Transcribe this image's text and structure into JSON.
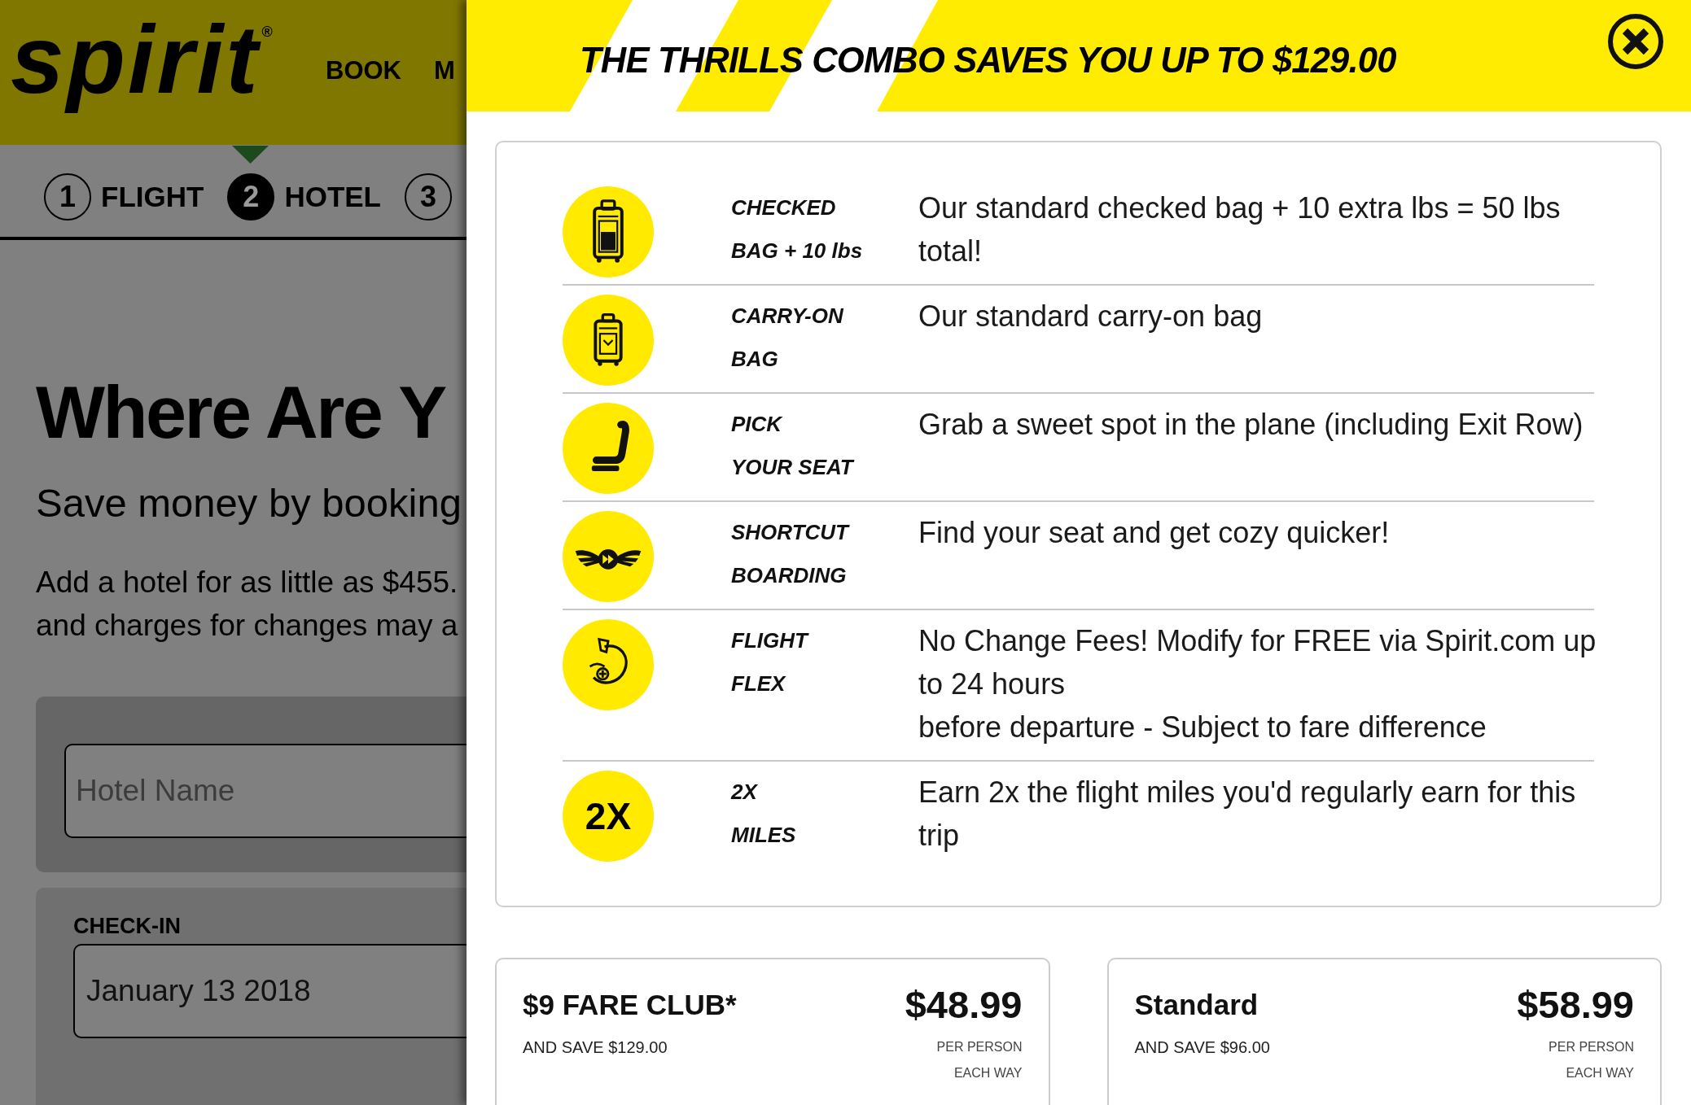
{
  "page": {
    "logo": "spirit$^{®}$",
    "nav": [
      "BOOK",
      "M"
    ],
    "steps": [
      {
        "number": "1",
        "label": "FLIGHT",
        "selected": false
      },
      {
        "number": "2",
        "label": "HOTEL",
        "selected": true
      },
      {
        "number": "3",
        "selected": false
      }
    ],
    "heading": "Where Are Y",
    "subheading": "Save money by booking",
    "intro": "Add a hotel for as little as $455.\nand charges for changes may a",
    "hotel_search": {
      "placeholder": "Hotel Name"
    },
    "check_in": {
      "label": "CHECK-IN",
      "value": "January 13 2018"
    }
  },
  "dialog": {
    "title": "THE THRILLS COMBO SAVES YOU UP TO $129.00",
    "benefits": [
      {
        "title": "CHECKED\nBAG + 10 lbs",
        "description": "Our standard checked bag + 10 extra lbs = 50 lbs total!"
      },
      {
        "title": "CARRY-ON\nBAG",
        "description": "Our standard carry-on bag"
      },
      {
        "title": "PICK\nYOUR SEAT",
        "description": "Grab a sweet spot in the plane (including Exit Row)"
      },
      {
        "title": "SHORTCUT\nBOARDING",
        "description": "Find your seat and get cozy quicker!"
      },
      {
        "title": "FLIGHT\nFLEX",
        "description": "No Change Fees! Modify for FREE via Spirit.com up to 24 hours\nbefore departure - Subject to fare difference"
      },
      {
        "title": "2X\nMILES",
        "badge": "2X",
        "description": "Earn 2x the flight miles you'd regularly earn for this trip"
      }
    ],
    "fares": [
      {
        "name": "$9 FARE CLUB*",
        "savings": "AND SAVE $129.00",
        "price": "$48.99",
        "note": "PER PERSON EACH WAY"
      },
      {
        "name": "Standard",
        "savings": "AND SAVE $96.00",
        "price": "$58.99",
        "note": "PER PERSON EACH WAY"
      }
    ]
  }
}
